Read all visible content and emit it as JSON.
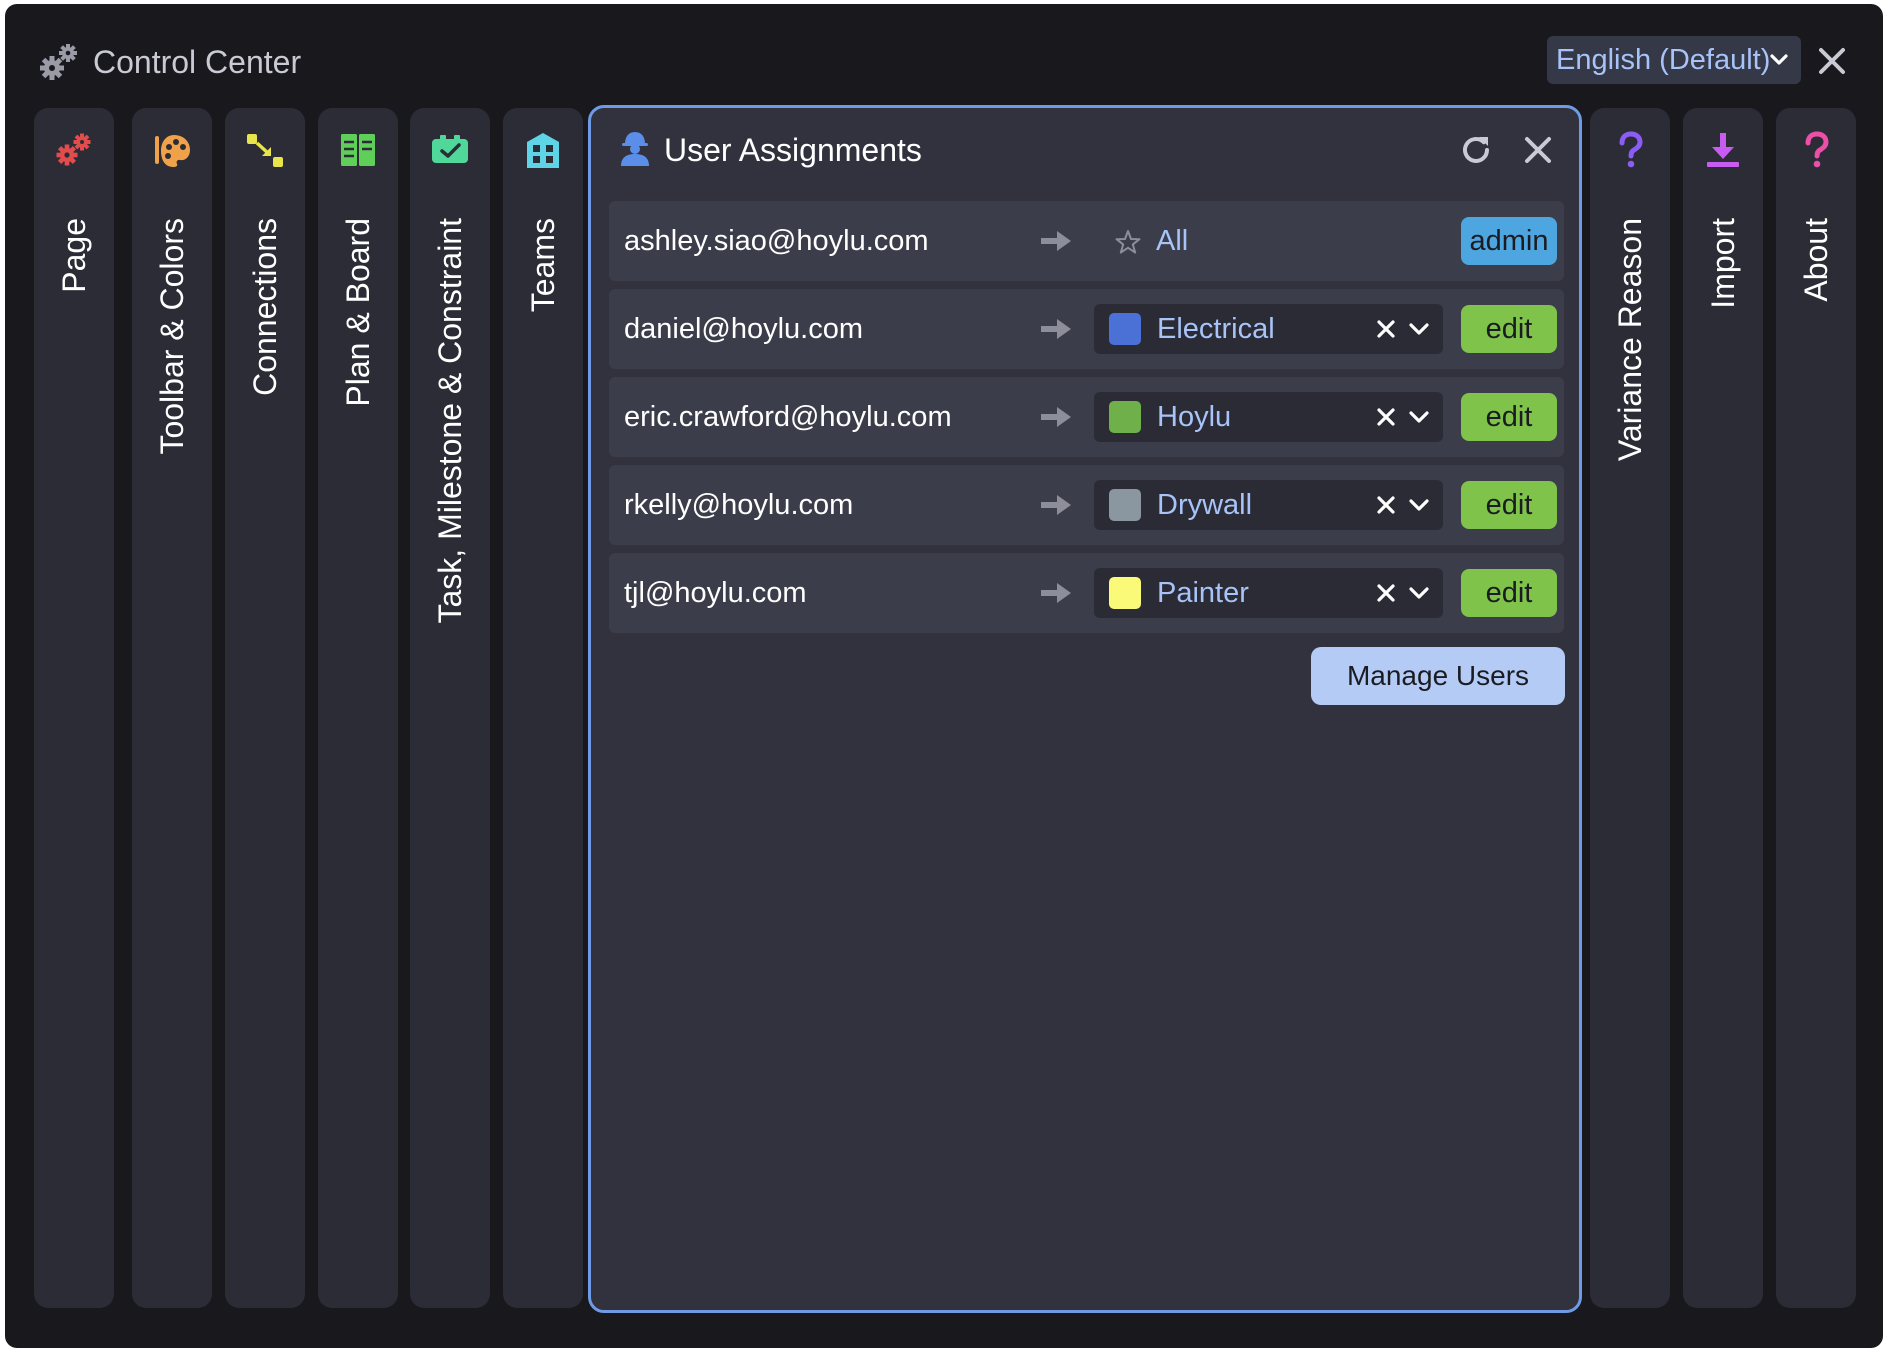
{
  "window": {
    "title": "Control Center",
    "icon": "gears-icon",
    "language": "English (Default)"
  },
  "tabs": [
    {
      "label": "Page",
      "icon": "gears-icon",
      "color": "#e24c4c"
    },
    {
      "label": "Toolbar & Colors",
      "icon": "palette-icon",
      "color": "#f0a24a"
    },
    {
      "label": "Connections",
      "icon": "connection-icon",
      "color": "#e9e44a"
    },
    {
      "label": "Plan & Board",
      "icon": "board-columns-icon",
      "color": "#5fcf5a"
    },
    {
      "label": "Task, Milestone & Constraint",
      "icon": "task-card-icon",
      "color": "#4fd89a"
    },
    {
      "label": "Teams",
      "icon": "building-icon",
      "color": "#5fd4e6"
    },
    {
      "label": "Variance Reason",
      "icon": "question-icon",
      "color": "#8b5cf6"
    },
    {
      "label": "Import",
      "icon": "download-icon",
      "color": "#c85cf0"
    },
    {
      "label": "About",
      "icon": "question-icon",
      "color": "#ec4fa8"
    }
  ],
  "panel": {
    "title": "User Assignments",
    "icon": "user-worker-icon",
    "rows": [
      {
        "email": "ashley.siao@hoylu.com",
        "team": "All",
        "role": "admin",
        "role_color": "#4da6e0"
      },
      {
        "email": "daniel@hoylu.com",
        "team": "Electrical",
        "team_color": "#4c71d6",
        "role": "edit",
        "role_color": "#7fc34a"
      },
      {
        "email": "eric.crawford@hoylu.com",
        "team": "Hoylu",
        "team_color": "#70b04a",
        "role": "edit",
        "role_color": "#7fc34a"
      },
      {
        "email": "rkelly@hoylu.com",
        "team": "Drywall",
        "team_color": "#8a96a0",
        "role": "edit",
        "role_color": "#7fc34a"
      },
      {
        "email": "tjl@hoylu.com",
        "team": "Painter",
        "team_color": "#fafa78",
        "role": "edit",
        "role_color": "#7fc34a"
      }
    ],
    "manage_button": "Manage Users"
  },
  "colors": {
    "accent_border": "#6f9be6",
    "link_text": "#a8c3f7"
  }
}
